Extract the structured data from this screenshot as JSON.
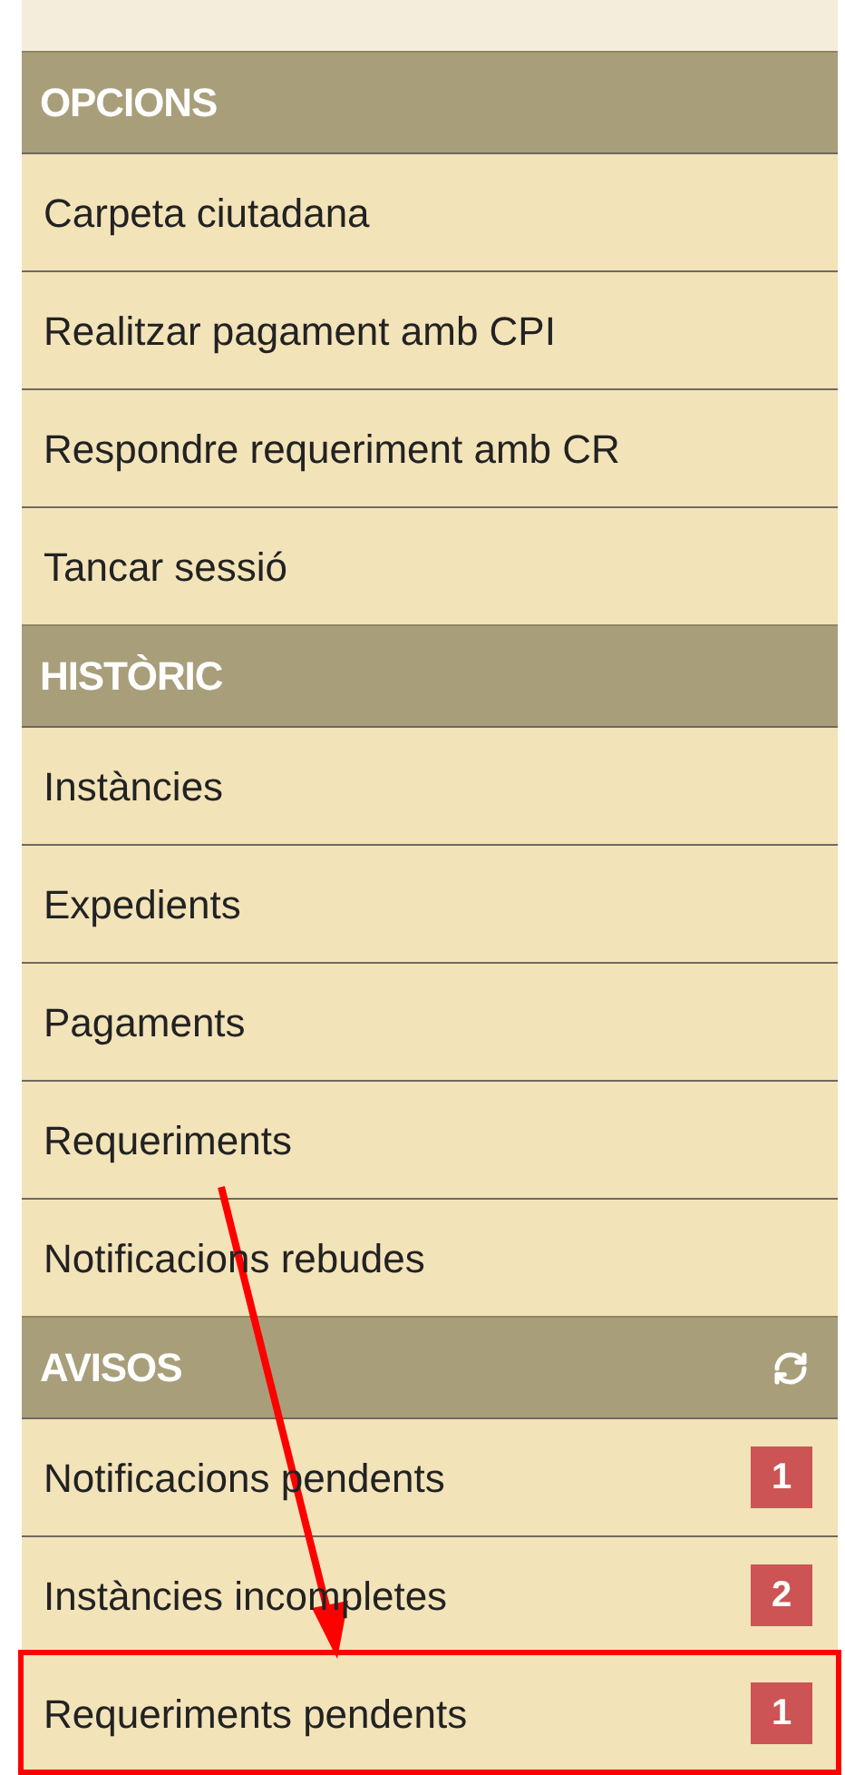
{
  "sections": [
    {
      "title": "OPCIONS",
      "refresh": false,
      "items": [
        {
          "label": "Carpeta ciutadana",
          "highlighted": false
        },
        {
          "label": "Realitzar pagament amb CPI",
          "highlighted": false
        },
        {
          "label": "Respondre requeriment amb CR",
          "highlighted": false
        },
        {
          "label": "Tancar sessió",
          "highlighted": false
        }
      ]
    },
    {
      "title": "HISTÒRIC",
      "refresh": false,
      "items": [
        {
          "label": "Instàncies",
          "highlighted": false
        },
        {
          "label": "Expedients",
          "highlighted": false
        },
        {
          "label": "Pagaments",
          "highlighted": false
        },
        {
          "label": "Requeriments",
          "highlighted": false
        },
        {
          "label": "Notificacions rebudes",
          "highlighted": false
        }
      ]
    },
    {
      "title": "AVISOS",
      "refresh": true,
      "items": [
        {
          "label": "Notificacions pendents",
          "badge": "1",
          "highlighted": false
        },
        {
          "label": "Instàncies incompletes",
          "badge": "2",
          "highlighted": false
        },
        {
          "label": "Requeriments pendents",
          "badge": "1",
          "highlighted": true
        }
      ]
    }
  ]
}
